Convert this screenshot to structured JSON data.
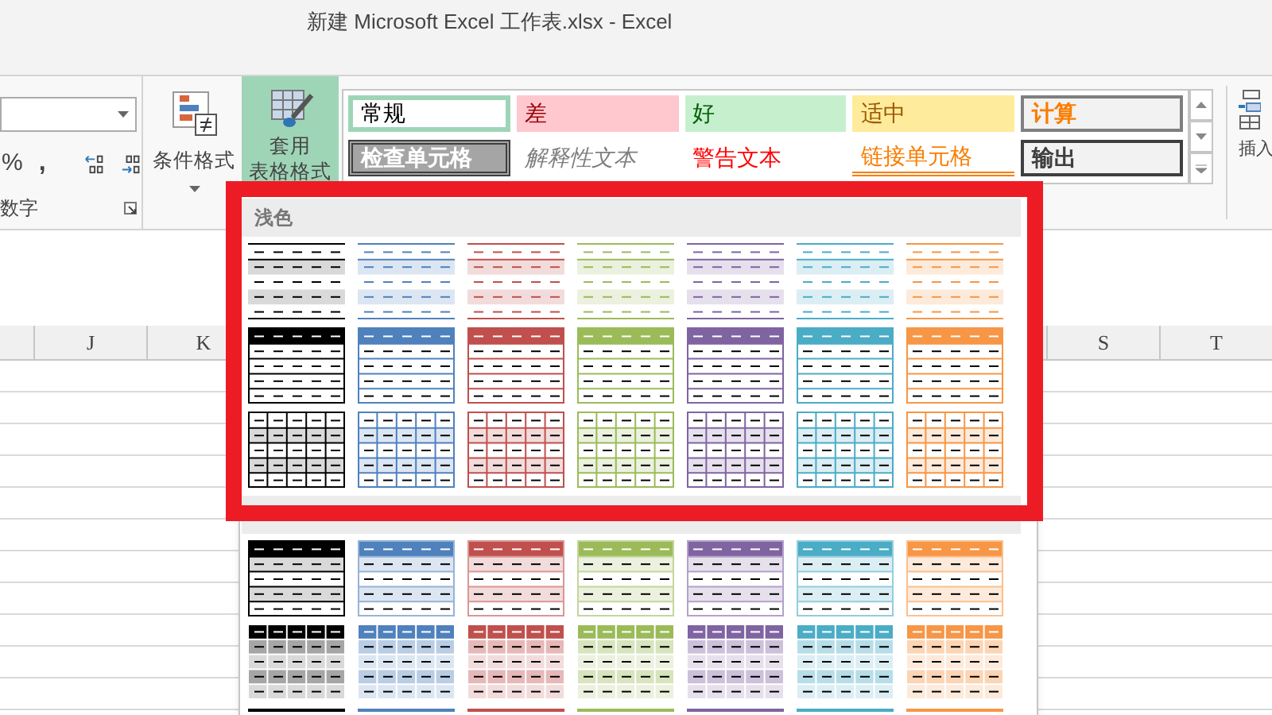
{
  "window": {
    "title": "新建 Microsoft Excel 工作表.xlsx - Excel"
  },
  "ribbon": {
    "number_group": {
      "label": "数字",
      "percent": "%",
      "comma": ","
    },
    "conditional_format": {
      "label": "条件格式"
    },
    "table_format": {
      "label_lines": [
        "套用",
        "表格格式"
      ],
      "selected": true
    },
    "cell_styles": [
      {
        "kind": "normal",
        "label": "常规"
      },
      {
        "kind": "bad",
        "label": "差"
      },
      {
        "kind": "good",
        "label": "好"
      },
      {
        "kind": "neutral",
        "label": "适中"
      },
      {
        "kind": "calculation",
        "label": "计算"
      },
      {
        "kind": "check",
        "label": "检查单元格"
      },
      {
        "kind": "explanatory",
        "label": "解释性文本"
      },
      {
        "kind": "warning",
        "label": "警告文本"
      },
      {
        "kind": "linked",
        "label": "链接单元格"
      },
      {
        "kind": "output",
        "label": "输出"
      }
    ],
    "insert": {
      "label": "插入"
    }
  },
  "columns": {
    "left": [
      "J",
      "K"
    ],
    "right": [
      "S",
      "T"
    ]
  },
  "gallery": {
    "colors": [
      {
        "color": "#000000"
      },
      {
        "color": "#4f81bd"
      },
      {
        "color": "#c0504d"
      },
      {
        "color": "#9bbb59"
      },
      {
        "color": "#8064a2"
      },
      {
        "color": "#4bacc6"
      },
      {
        "color": "#f79646"
      }
    ],
    "sections": [
      {
        "label": "浅色",
        "rows": [
          {
            "kind": "light-banded"
          },
          {
            "kind": "header-bordered"
          },
          {
            "kind": "grid-banded"
          }
        ]
      },
      {
        "rows": [
          {
            "kind": "medium-header-banded"
          },
          {
            "kind": "medium-grid"
          },
          {
            "kind": "top-line"
          }
        ]
      }
    ]
  }
}
